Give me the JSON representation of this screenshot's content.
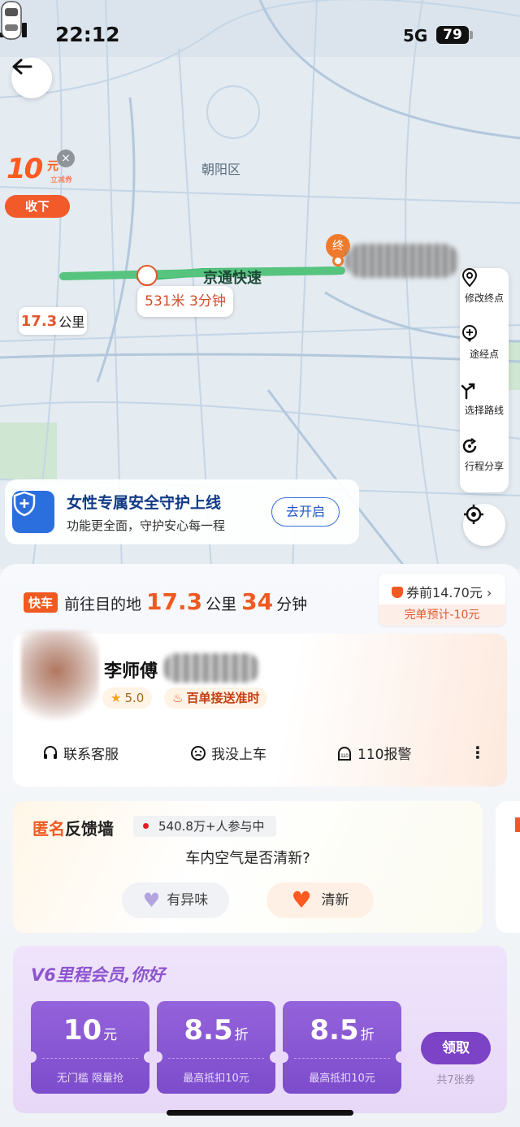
{
  "status_bar": {
    "time": "22:12",
    "network": "5G",
    "battery": "79"
  },
  "map": {
    "district": "朝阳区",
    "road": "京通快速",
    "destination_marker": "终",
    "distance_value": "17.3",
    "distance_unit": "公里",
    "route_tip": "531米 3分钟"
  },
  "coupon": {
    "amount": "10",
    "unit": "元",
    "subtitle": "立减券",
    "button": "收下"
  },
  "map_tools": [
    {
      "label": "修改终点",
      "icon": "location-pin-icon"
    },
    {
      "label": "途经点",
      "icon": "add-waypoint-icon"
    },
    {
      "label": "选择路线",
      "icon": "route-fork-icon"
    },
    {
      "label": "行程分享",
      "icon": "share-trip-icon"
    }
  ],
  "safety_banner": {
    "title": "女性专属安全守护上线",
    "subtitle": "功能更全面，守护安心每一程",
    "button": "去开启"
  },
  "trip": {
    "tag": "快车",
    "prefix": "前往目的地",
    "distance": "17.3",
    "distance_unit": "公里",
    "minutes": "34",
    "minutes_unit": "分钟",
    "price_label": "券前14.70元",
    "price_note": "完单预计-10元"
  },
  "driver": {
    "name": "李师傅",
    "rating": "5.0",
    "honor": "百单接送准时",
    "actions": [
      "联系客服",
      "我没上车",
      "110报警"
    ]
  },
  "feedback": {
    "title_highlight": "匿名",
    "title_rest": "反馈墙",
    "count": "540.8万+人参与中",
    "question": "车内空气是否清新?",
    "option_negative": "有异味",
    "option_positive": "清新"
  },
  "member": {
    "title": "V6里程会员,你好",
    "vouchers": [
      {
        "amount": "10",
        "unit": "元",
        "note": "无门槛 限量抢"
      },
      {
        "amount": "8.5",
        "unit": "折",
        "note": "最高抵扣10元"
      },
      {
        "amount": "8.5",
        "unit": "折",
        "note": "最高抵扣10元"
      }
    ],
    "claim_button": "领取",
    "claim_note": "共7张券"
  },
  "colors": {
    "accent_orange": "#f05a22",
    "route_green": "#3bb56a",
    "member_purple": "#7d43c7",
    "safety_blue": "#2b6fde"
  }
}
